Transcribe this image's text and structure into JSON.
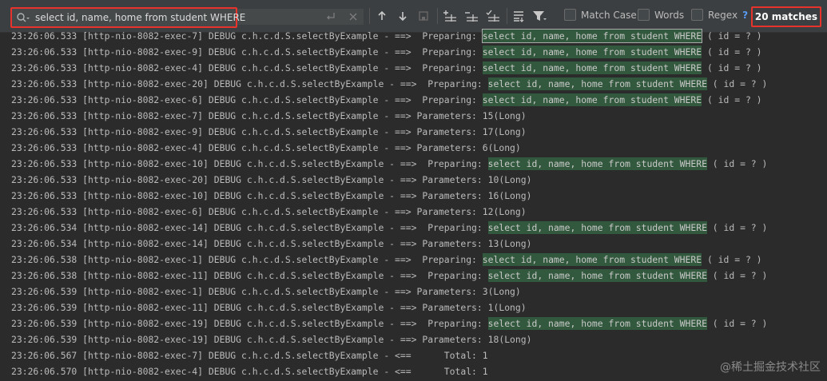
{
  "search": {
    "query": "select id, name, home from student WHERE"
  },
  "options": {
    "match_case": "Match Case",
    "words": "Words",
    "regex": "Regex",
    "help": "?"
  },
  "match_count": "20 matches",
  "log_lines": [
    {
      "prefix": "23:26:06.533 [http-nio-8082-exec-7] DEBUG c.h.c.d.S.selectByExample - ==>  Preparing: ",
      "match": "select id, name, home from student WHERE",
      "suffix": " ( id = ? )"
    },
    {
      "prefix": "23:26:06.533 [http-nio-8082-exec-9] DEBUG c.h.c.d.S.selectByExample - ==>  Preparing: ",
      "match": "select id, name, home from student WHERE",
      "suffix": " ( id = ? )"
    },
    {
      "prefix": "23:26:06.533 [http-nio-8082-exec-4] DEBUG c.h.c.d.S.selectByExample - ==>  Preparing: ",
      "match": "select id, name, home from student WHERE",
      "suffix": " ( id = ? )"
    },
    {
      "prefix": "23:26:06.533 [http-nio-8082-exec-20] DEBUG c.h.c.d.S.selectByExample - ==>  Preparing: ",
      "match": "select id, name, home from student WHERE",
      "suffix": " ( id = ? )"
    },
    {
      "prefix": "23:26:06.533 [http-nio-8082-exec-6] DEBUG c.h.c.d.S.selectByExample - ==>  Preparing: ",
      "match": "select id, name, home from student WHERE",
      "suffix": " ( id = ? )"
    },
    {
      "prefix": "23:26:06.533 [http-nio-8082-exec-7] DEBUG c.h.c.d.S.selectByExample - ==> Parameters: 15(Long)",
      "match": "",
      "suffix": ""
    },
    {
      "prefix": "23:26:06.533 [http-nio-8082-exec-9] DEBUG c.h.c.d.S.selectByExample - ==> Parameters: 17(Long)",
      "match": "",
      "suffix": ""
    },
    {
      "prefix": "23:26:06.533 [http-nio-8082-exec-4] DEBUG c.h.c.d.S.selectByExample - ==> Parameters: 6(Long)",
      "match": "",
      "suffix": ""
    },
    {
      "prefix": "23:26:06.533 [http-nio-8082-exec-10] DEBUG c.h.c.d.S.selectByExample - ==>  Preparing: ",
      "match": "select id, name, home from student WHERE",
      "suffix": " ( id = ? )"
    },
    {
      "prefix": "23:26:06.533 [http-nio-8082-exec-20] DEBUG c.h.c.d.S.selectByExample - ==> Parameters: 10(Long)",
      "match": "",
      "suffix": ""
    },
    {
      "prefix": "23:26:06.533 [http-nio-8082-exec-10] DEBUG c.h.c.d.S.selectByExample - ==> Parameters: 16(Long)",
      "match": "",
      "suffix": ""
    },
    {
      "prefix": "23:26:06.533 [http-nio-8082-exec-6] DEBUG c.h.c.d.S.selectByExample - ==> Parameters: 12(Long)",
      "match": "",
      "suffix": ""
    },
    {
      "prefix": "23:26:06.534 [http-nio-8082-exec-14] DEBUG c.h.c.d.S.selectByExample - ==>  Preparing: ",
      "match": "select id, name, home from student WHERE",
      "suffix": " ( id = ? )"
    },
    {
      "prefix": "23:26:06.534 [http-nio-8082-exec-14] DEBUG c.h.c.d.S.selectByExample - ==> Parameters: 13(Long)",
      "match": "",
      "suffix": ""
    },
    {
      "prefix": "23:26:06.538 [http-nio-8082-exec-1] DEBUG c.h.c.d.S.selectByExample - ==>  Preparing: ",
      "match": "select id, name, home from student WHERE",
      "suffix": " ( id = ? )"
    },
    {
      "prefix": "23:26:06.538 [http-nio-8082-exec-11] DEBUG c.h.c.d.S.selectByExample - ==>  Preparing: ",
      "match": "select id, name, home from student WHERE",
      "suffix": " ( id = ? )"
    },
    {
      "prefix": "23:26:06.539 [http-nio-8082-exec-1] DEBUG c.h.c.d.S.selectByExample - ==> Parameters: 3(Long)",
      "match": "",
      "suffix": ""
    },
    {
      "prefix": "23:26:06.539 [http-nio-8082-exec-11] DEBUG c.h.c.d.S.selectByExample - ==> Parameters: 1(Long)",
      "match": "",
      "suffix": ""
    },
    {
      "prefix": "23:26:06.539 [http-nio-8082-exec-19] DEBUG c.h.c.d.S.selectByExample - ==>  Preparing: ",
      "match": "select id, name, home from student WHERE",
      "suffix": " ( id = ? )"
    },
    {
      "prefix": "23:26:06.539 [http-nio-8082-exec-19] DEBUG c.h.c.d.S.selectByExample - ==> Parameters: 18(Long)",
      "match": "",
      "suffix": ""
    },
    {
      "prefix": "23:26:06.567 [http-nio-8082-exec-7] DEBUG c.h.c.d.S.selectByExample - <==      Total: 1",
      "match": "",
      "suffix": ""
    },
    {
      "prefix": "23:26:06.570 [http-nio-8082-exec-4] DEBUG c.h.c.d.S.selectByExample - <==      Total: 1",
      "match": "",
      "suffix": ""
    }
  ],
  "watermark": "@稀土掘金技术社区",
  "colors": {
    "background": "#2b2b2b",
    "toolbar": "#3c3f41",
    "highlight": "#32593d",
    "annotation_border": "#e8332d"
  }
}
